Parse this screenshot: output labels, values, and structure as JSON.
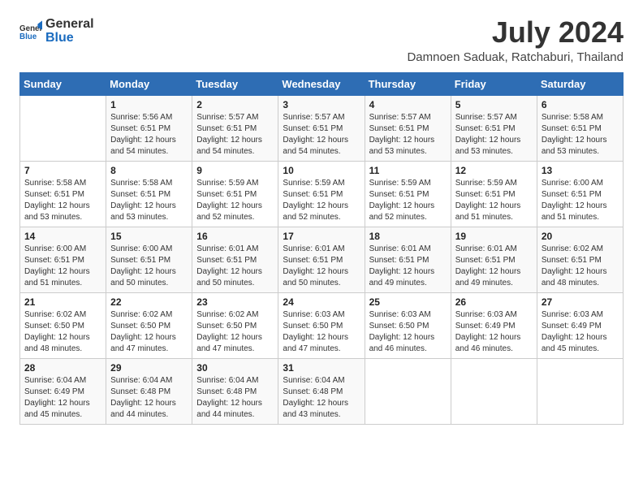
{
  "logo": {
    "text_general": "General",
    "text_blue": "Blue"
  },
  "header": {
    "title": "July 2024",
    "subtitle": "Damnoen Saduak, Ratchaburi, Thailand"
  },
  "days_of_week": [
    "Sunday",
    "Monday",
    "Tuesday",
    "Wednesday",
    "Thursday",
    "Friday",
    "Saturday"
  ],
  "weeks": [
    [
      {
        "day": "",
        "sunrise": "",
        "sunset": "",
        "daylight": ""
      },
      {
        "day": "1",
        "sunrise": "Sunrise: 5:56 AM",
        "sunset": "Sunset: 6:51 PM",
        "daylight": "Daylight: 12 hours and 54 minutes."
      },
      {
        "day": "2",
        "sunrise": "Sunrise: 5:57 AM",
        "sunset": "Sunset: 6:51 PM",
        "daylight": "Daylight: 12 hours and 54 minutes."
      },
      {
        "day": "3",
        "sunrise": "Sunrise: 5:57 AM",
        "sunset": "Sunset: 6:51 PM",
        "daylight": "Daylight: 12 hours and 54 minutes."
      },
      {
        "day": "4",
        "sunrise": "Sunrise: 5:57 AM",
        "sunset": "Sunset: 6:51 PM",
        "daylight": "Daylight: 12 hours and 53 minutes."
      },
      {
        "day": "5",
        "sunrise": "Sunrise: 5:57 AM",
        "sunset": "Sunset: 6:51 PM",
        "daylight": "Daylight: 12 hours and 53 minutes."
      },
      {
        "day": "6",
        "sunrise": "Sunrise: 5:58 AM",
        "sunset": "Sunset: 6:51 PM",
        "daylight": "Daylight: 12 hours and 53 minutes."
      }
    ],
    [
      {
        "day": "7",
        "sunrise": "Sunrise: 5:58 AM",
        "sunset": "Sunset: 6:51 PM",
        "daylight": "Daylight: 12 hours and 53 minutes."
      },
      {
        "day": "8",
        "sunrise": "Sunrise: 5:58 AM",
        "sunset": "Sunset: 6:51 PM",
        "daylight": "Daylight: 12 hours and 53 minutes."
      },
      {
        "day": "9",
        "sunrise": "Sunrise: 5:59 AM",
        "sunset": "Sunset: 6:51 PM",
        "daylight": "Daylight: 12 hours and 52 minutes."
      },
      {
        "day": "10",
        "sunrise": "Sunrise: 5:59 AM",
        "sunset": "Sunset: 6:51 PM",
        "daylight": "Daylight: 12 hours and 52 minutes."
      },
      {
        "day": "11",
        "sunrise": "Sunrise: 5:59 AM",
        "sunset": "Sunset: 6:51 PM",
        "daylight": "Daylight: 12 hours and 52 minutes."
      },
      {
        "day": "12",
        "sunrise": "Sunrise: 5:59 AM",
        "sunset": "Sunset: 6:51 PM",
        "daylight": "Daylight: 12 hours and 51 minutes."
      },
      {
        "day": "13",
        "sunrise": "Sunrise: 6:00 AM",
        "sunset": "Sunset: 6:51 PM",
        "daylight": "Daylight: 12 hours and 51 minutes."
      }
    ],
    [
      {
        "day": "14",
        "sunrise": "Sunrise: 6:00 AM",
        "sunset": "Sunset: 6:51 PM",
        "daylight": "Daylight: 12 hours and 51 minutes."
      },
      {
        "day": "15",
        "sunrise": "Sunrise: 6:00 AM",
        "sunset": "Sunset: 6:51 PM",
        "daylight": "Daylight: 12 hours and 50 minutes."
      },
      {
        "day": "16",
        "sunrise": "Sunrise: 6:01 AM",
        "sunset": "Sunset: 6:51 PM",
        "daylight": "Daylight: 12 hours and 50 minutes."
      },
      {
        "day": "17",
        "sunrise": "Sunrise: 6:01 AM",
        "sunset": "Sunset: 6:51 PM",
        "daylight": "Daylight: 12 hours and 50 minutes."
      },
      {
        "day": "18",
        "sunrise": "Sunrise: 6:01 AM",
        "sunset": "Sunset: 6:51 PM",
        "daylight": "Daylight: 12 hours and 49 minutes."
      },
      {
        "day": "19",
        "sunrise": "Sunrise: 6:01 AM",
        "sunset": "Sunset: 6:51 PM",
        "daylight": "Daylight: 12 hours and 49 minutes."
      },
      {
        "day": "20",
        "sunrise": "Sunrise: 6:02 AM",
        "sunset": "Sunset: 6:51 PM",
        "daylight": "Daylight: 12 hours and 48 minutes."
      }
    ],
    [
      {
        "day": "21",
        "sunrise": "Sunrise: 6:02 AM",
        "sunset": "Sunset: 6:50 PM",
        "daylight": "Daylight: 12 hours and 48 minutes."
      },
      {
        "day": "22",
        "sunrise": "Sunrise: 6:02 AM",
        "sunset": "Sunset: 6:50 PM",
        "daylight": "Daylight: 12 hours and 47 minutes."
      },
      {
        "day": "23",
        "sunrise": "Sunrise: 6:02 AM",
        "sunset": "Sunset: 6:50 PM",
        "daylight": "Daylight: 12 hours and 47 minutes."
      },
      {
        "day": "24",
        "sunrise": "Sunrise: 6:03 AM",
        "sunset": "Sunset: 6:50 PM",
        "daylight": "Daylight: 12 hours and 47 minutes."
      },
      {
        "day": "25",
        "sunrise": "Sunrise: 6:03 AM",
        "sunset": "Sunset: 6:50 PM",
        "daylight": "Daylight: 12 hours and 46 minutes."
      },
      {
        "day": "26",
        "sunrise": "Sunrise: 6:03 AM",
        "sunset": "Sunset: 6:49 PM",
        "daylight": "Daylight: 12 hours and 46 minutes."
      },
      {
        "day": "27",
        "sunrise": "Sunrise: 6:03 AM",
        "sunset": "Sunset: 6:49 PM",
        "daylight": "Daylight: 12 hours and 45 minutes."
      }
    ],
    [
      {
        "day": "28",
        "sunrise": "Sunrise: 6:04 AM",
        "sunset": "Sunset: 6:49 PM",
        "daylight": "Daylight: 12 hours and 45 minutes."
      },
      {
        "day": "29",
        "sunrise": "Sunrise: 6:04 AM",
        "sunset": "Sunset: 6:48 PM",
        "daylight": "Daylight: 12 hours and 44 minutes."
      },
      {
        "day": "30",
        "sunrise": "Sunrise: 6:04 AM",
        "sunset": "Sunset: 6:48 PM",
        "daylight": "Daylight: 12 hours and 44 minutes."
      },
      {
        "day": "31",
        "sunrise": "Sunrise: 6:04 AM",
        "sunset": "Sunset: 6:48 PM",
        "daylight": "Daylight: 12 hours and 43 minutes."
      },
      {
        "day": "",
        "sunrise": "",
        "sunset": "",
        "daylight": ""
      },
      {
        "day": "",
        "sunrise": "",
        "sunset": "",
        "daylight": ""
      },
      {
        "day": "",
        "sunrise": "",
        "sunset": "",
        "daylight": ""
      }
    ]
  ]
}
